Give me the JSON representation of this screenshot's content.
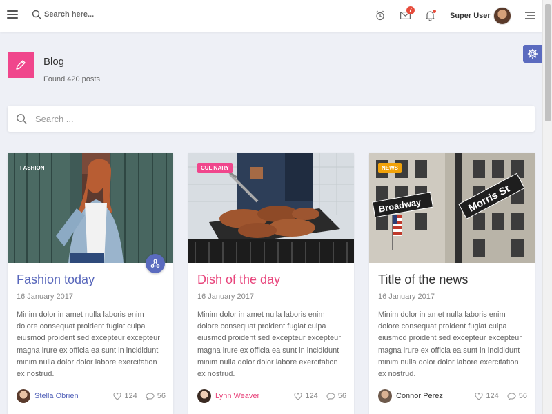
{
  "topbar": {
    "search_placeholder": "Search here...",
    "mail_badge": "7",
    "user_name": "Super User"
  },
  "header": {
    "title": "Blog",
    "subtitle": "Found 420 posts"
  },
  "main_search": {
    "placeholder": "Search ..."
  },
  "colors": {
    "accent": "#5b6bbf",
    "pink": "#f0468c",
    "culinary_title": "#e8457c",
    "fashion_title": "#5867bb",
    "news_tag": "#f1a20a"
  },
  "cards": [
    {
      "tag": "FASHION",
      "title": "Fashion today",
      "date": "16 January 2017",
      "text": "Minim dolor in amet nulla laboris enim dolore consequat proident fugiat culpa eiusmod proident sed excepteur excepteur magna irure ex officia ea sunt in incididunt minim nulla dolor dolor labore exercitation ex nostrud.",
      "author": "Stella Obrien",
      "likes": "124",
      "comments": "56"
    },
    {
      "tag": "CULINARY",
      "title": "Dish of the day",
      "date": "16 January 2017",
      "text": "Minim dolor in amet nulla laboris enim dolore consequat proident fugiat culpa eiusmod proident sed excepteur excepteur magna irure ex officia ea sunt in incididunt minim nulla dolor dolor labore exercitation ex nostrud.",
      "author": "Lynn Weaver",
      "likes": "124",
      "comments": "56"
    },
    {
      "tag": "NEWS",
      "title": "Title of the news",
      "date": "16 January 2017",
      "text": "Minim dolor in amet nulla laboris enim dolore consequat proident fugiat culpa eiusmod proident sed excepteur excepteur magna irure ex officia ea sunt in incididunt minim nulla dolor dolor labore exercitation ex nostrud.",
      "author": "Connor Perez",
      "likes": "124",
      "comments": "56",
      "street_signs": [
        "Broadway",
        "Morris St"
      ]
    }
  ]
}
